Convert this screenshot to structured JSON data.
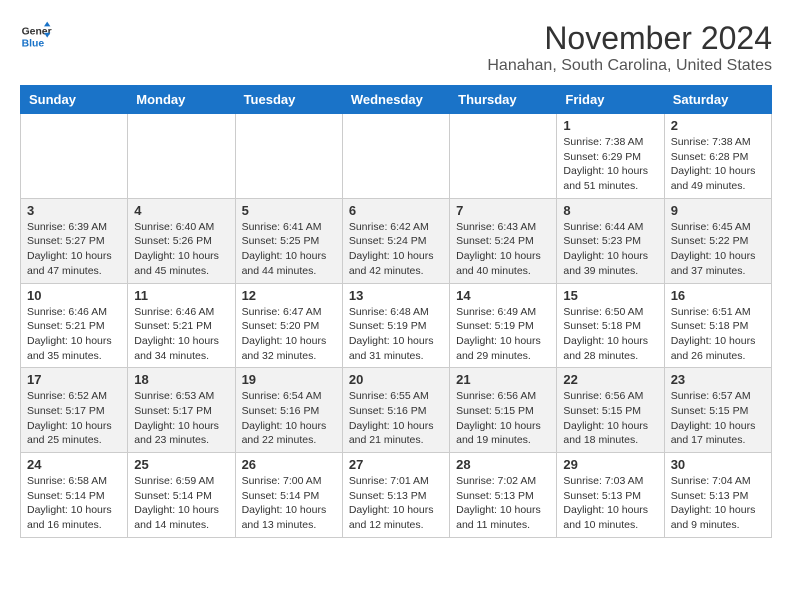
{
  "logo": {
    "line1": "General",
    "line2": "Blue"
  },
  "title": "November 2024",
  "location": "Hanahan, South Carolina, United States",
  "weekdays": [
    "Sunday",
    "Monday",
    "Tuesday",
    "Wednesday",
    "Thursday",
    "Friday",
    "Saturday"
  ],
  "rows": [
    [
      {
        "day": "",
        "info": ""
      },
      {
        "day": "",
        "info": ""
      },
      {
        "day": "",
        "info": ""
      },
      {
        "day": "",
        "info": ""
      },
      {
        "day": "",
        "info": ""
      },
      {
        "day": "1",
        "info": "Sunrise: 7:38 AM\nSunset: 6:29 PM\nDaylight: 10 hours\nand 51 minutes."
      },
      {
        "day": "2",
        "info": "Sunrise: 7:38 AM\nSunset: 6:28 PM\nDaylight: 10 hours\nand 49 minutes."
      }
    ],
    [
      {
        "day": "3",
        "info": "Sunrise: 6:39 AM\nSunset: 5:27 PM\nDaylight: 10 hours\nand 47 minutes."
      },
      {
        "day": "4",
        "info": "Sunrise: 6:40 AM\nSunset: 5:26 PM\nDaylight: 10 hours\nand 45 minutes."
      },
      {
        "day": "5",
        "info": "Sunrise: 6:41 AM\nSunset: 5:25 PM\nDaylight: 10 hours\nand 44 minutes."
      },
      {
        "day": "6",
        "info": "Sunrise: 6:42 AM\nSunset: 5:24 PM\nDaylight: 10 hours\nand 42 minutes."
      },
      {
        "day": "7",
        "info": "Sunrise: 6:43 AM\nSunset: 5:24 PM\nDaylight: 10 hours\nand 40 minutes."
      },
      {
        "day": "8",
        "info": "Sunrise: 6:44 AM\nSunset: 5:23 PM\nDaylight: 10 hours\nand 39 minutes."
      },
      {
        "day": "9",
        "info": "Sunrise: 6:45 AM\nSunset: 5:22 PM\nDaylight: 10 hours\nand 37 minutes."
      }
    ],
    [
      {
        "day": "10",
        "info": "Sunrise: 6:46 AM\nSunset: 5:21 PM\nDaylight: 10 hours\nand 35 minutes."
      },
      {
        "day": "11",
        "info": "Sunrise: 6:46 AM\nSunset: 5:21 PM\nDaylight: 10 hours\nand 34 minutes."
      },
      {
        "day": "12",
        "info": "Sunrise: 6:47 AM\nSunset: 5:20 PM\nDaylight: 10 hours\nand 32 minutes."
      },
      {
        "day": "13",
        "info": "Sunrise: 6:48 AM\nSunset: 5:19 PM\nDaylight: 10 hours\nand 31 minutes."
      },
      {
        "day": "14",
        "info": "Sunrise: 6:49 AM\nSunset: 5:19 PM\nDaylight: 10 hours\nand 29 minutes."
      },
      {
        "day": "15",
        "info": "Sunrise: 6:50 AM\nSunset: 5:18 PM\nDaylight: 10 hours\nand 28 minutes."
      },
      {
        "day": "16",
        "info": "Sunrise: 6:51 AM\nSunset: 5:18 PM\nDaylight: 10 hours\nand 26 minutes."
      }
    ],
    [
      {
        "day": "17",
        "info": "Sunrise: 6:52 AM\nSunset: 5:17 PM\nDaylight: 10 hours\nand 25 minutes."
      },
      {
        "day": "18",
        "info": "Sunrise: 6:53 AM\nSunset: 5:17 PM\nDaylight: 10 hours\nand 23 minutes."
      },
      {
        "day": "19",
        "info": "Sunrise: 6:54 AM\nSunset: 5:16 PM\nDaylight: 10 hours\nand 22 minutes."
      },
      {
        "day": "20",
        "info": "Sunrise: 6:55 AM\nSunset: 5:16 PM\nDaylight: 10 hours\nand 21 minutes."
      },
      {
        "day": "21",
        "info": "Sunrise: 6:56 AM\nSunset: 5:15 PM\nDaylight: 10 hours\nand 19 minutes."
      },
      {
        "day": "22",
        "info": "Sunrise: 6:56 AM\nSunset: 5:15 PM\nDaylight: 10 hours\nand 18 minutes."
      },
      {
        "day": "23",
        "info": "Sunrise: 6:57 AM\nSunset: 5:15 PM\nDaylight: 10 hours\nand 17 minutes."
      }
    ],
    [
      {
        "day": "24",
        "info": "Sunrise: 6:58 AM\nSunset: 5:14 PM\nDaylight: 10 hours\nand 16 minutes."
      },
      {
        "day": "25",
        "info": "Sunrise: 6:59 AM\nSunset: 5:14 PM\nDaylight: 10 hours\nand 14 minutes."
      },
      {
        "day": "26",
        "info": "Sunrise: 7:00 AM\nSunset: 5:14 PM\nDaylight: 10 hours\nand 13 minutes."
      },
      {
        "day": "27",
        "info": "Sunrise: 7:01 AM\nSunset: 5:13 PM\nDaylight: 10 hours\nand 12 minutes."
      },
      {
        "day": "28",
        "info": "Sunrise: 7:02 AM\nSunset: 5:13 PM\nDaylight: 10 hours\nand 11 minutes."
      },
      {
        "day": "29",
        "info": "Sunrise: 7:03 AM\nSunset: 5:13 PM\nDaylight: 10 hours\nand 10 minutes."
      },
      {
        "day": "30",
        "info": "Sunrise: 7:04 AM\nSunset: 5:13 PM\nDaylight: 10 hours\nand 9 minutes."
      }
    ]
  ]
}
